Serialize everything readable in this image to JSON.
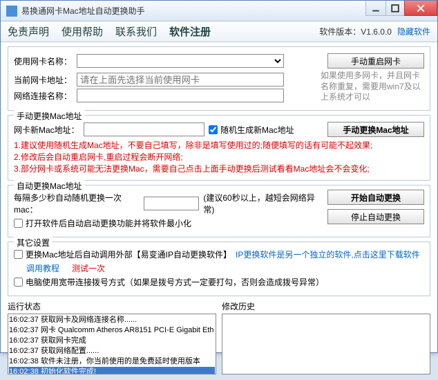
{
  "titlebar": {
    "title": "易换通网卡Mac地址自动更换助手"
  },
  "menu": {
    "item1": "免责声明",
    "item2": "使用帮助",
    "item3": "联系我们",
    "item4": "软件注册",
    "version": "软件版本：V1.6.0.0",
    "hide": "隐藏软件"
  },
  "card_info": {
    "name_label": "使用网卡名称：",
    "addr_label": "当前网卡地址：",
    "conn_label": "网络连接名称：",
    "addr_placeholder": "请在上面先选择当前使用网卡",
    "restart_btn": "手动重启网卡",
    "side_note": "如果使用多网卡，并且网卡名称重复，需要用win7及以上系统才可以"
  },
  "manual": {
    "legend": "手动更换Mac地址",
    "new_label": "网卡新Mac地址：",
    "random_cb": "随机生成新Mac地址",
    "change_btn": "手动更换Mac地址",
    "warn1": "1.建议使用随机生成Mac地址，不要自己填写，除非是填写使用过的;随便填写的话有可能不起效果;",
    "warn2": "2.修改后会自动重启网卡,重启过程会断开网络;",
    "warn3": "3.部分网卡或系统可能无法更换Mac，需要自己点击上面手动更换后测试看看Mac地址会不会变化;"
  },
  "auto": {
    "legend": "自动更换Mac地址",
    "interval_label": "每隔多少秒自动随机更换一次mac：",
    "interval_hint": "(建议60秒以上，越短会网络异常)",
    "startup_cb": "打开软件后自动启动更换功能并将软件最小化",
    "start_btn": "开始自动更换",
    "stop_btn": "停止自动更换"
  },
  "other": {
    "legend": "其它设置",
    "ext_cb_pre": "更换Mac地址后自动调用外部【易变通IP自动更换软件】",
    "ext_cb_link": "IP更换软件是另一个独立的软件,点击这里下载软件",
    "tutorial": "调用教程",
    "test_once": "测试一次",
    "dial_cb": "电脑使用宽带连接拨号方式（如果是拨号方式一定要打勾，否则会造成拨号异常）"
  },
  "run_status": {
    "label": "运行状态",
    "lines": [
      "16:02:37 获取网卡及网络连接名称......",
      "16:02:37 网卡 Qualcomm Atheros AR8151 PCI-E Gigabit Eth",
      "16:02:37 获取网卡完成",
      "16:02:37 获取网络配置......",
      "16:02:38 软件未注册，你当前使用的是免费延时使用版本",
      "16:02:38 初始化软件完成!"
    ]
  },
  "history": {
    "label": "修改历史"
  }
}
